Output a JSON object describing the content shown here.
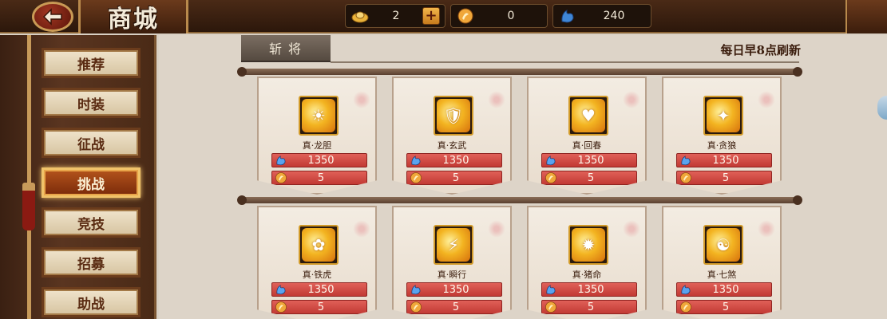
{
  "header": {
    "title": "商城",
    "currencies": [
      {
        "icon": "gold-ingot-icon",
        "value": "2",
        "has_plus": true
      },
      {
        "icon": "coin-icon",
        "value": "0",
        "has_plus": false
      },
      {
        "icon": "blue-crest-icon",
        "value": "240",
        "has_plus": false
      }
    ],
    "plus_label": "+"
  },
  "sidebar": {
    "items": [
      {
        "label": "推荐",
        "active": false
      },
      {
        "label": "时装",
        "active": false
      },
      {
        "label": "征战",
        "active": false
      },
      {
        "label": "挑战",
        "active": true
      },
      {
        "label": "竞技",
        "active": false
      },
      {
        "label": "招募",
        "active": false
      },
      {
        "label": "助战",
        "active": false
      }
    ]
  },
  "shop": {
    "tab_label": "斩将",
    "refresh_note": "每日早8点刷新",
    "cards": [
      {
        "name": "真·龙胆",
        "blue_price": "1350",
        "gold_price": "5"
      },
      {
        "name": "真·玄武",
        "blue_price": "1350",
        "gold_price": "5"
      },
      {
        "name": "真·回春",
        "blue_price": "1350",
        "gold_price": "5"
      },
      {
        "name": "真·贪狼",
        "blue_price": "1350",
        "gold_price": "5"
      },
      {
        "name": "真·铁虎",
        "blue_price": "1350",
        "gold_price": "5"
      },
      {
        "name": "真·瞬行",
        "blue_price": "1350",
        "gold_price": "5"
      },
      {
        "name": "真·猪命",
        "blue_price": "1350",
        "gold_price": "5"
      },
      {
        "name": "真·七煞",
        "blue_price": "1350",
        "gold_price": "5"
      }
    ]
  },
  "colors": {
    "accent_gold": "#f3b421",
    "price_red": "#c23a34",
    "active_tab": "#b4541c"
  }
}
